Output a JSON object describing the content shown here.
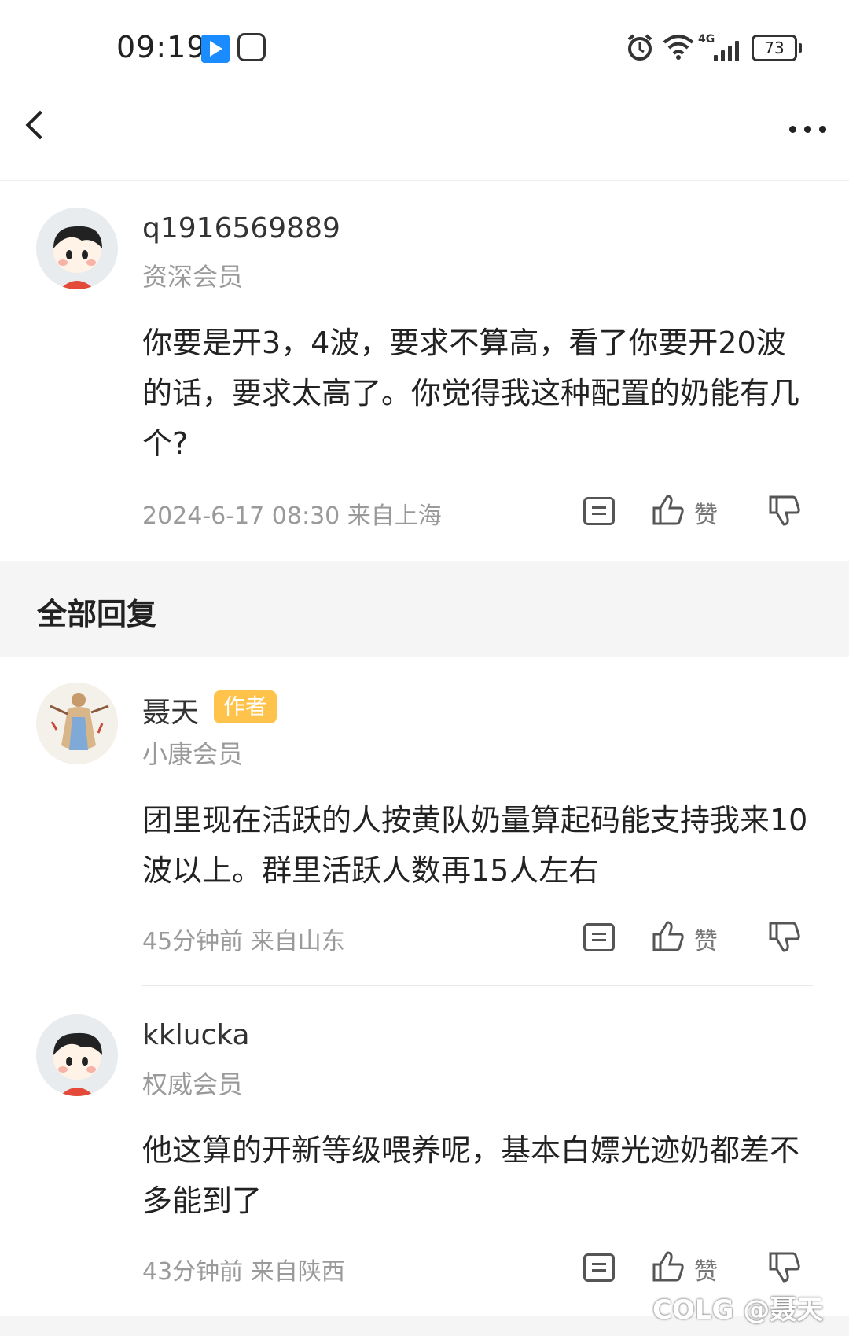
{
  "status_bar": {
    "time": "09:19",
    "battery": "73",
    "network": "4G"
  },
  "nav": {
    "back_icon": "chevron-left-icon",
    "more_icon": "more-horizontal-icon"
  },
  "main_comment": {
    "username": "q1916569889",
    "level": "资深会员",
    "content": "你要是开3，4波，要求不算高，看了你要开20波的话，要求太高了。你觉得我这种配置的奶能有几个?",
    "meta": "2024-6-17 08:30  来自上海",
    "like_label": "赞"
  },
  "section": {
    "title": "全部回复"
  },
  "replies": [
    {
      "username": "聂天",
      "badge": "作者",
      "level": "小康会员",
      "content": "团里现在活跃的人按黄队奶量算起码能支持我来10波以上。群里活跃人数再15人左右",
      "meta": "45分钟前  来自山东",
      "like_label": "赞"
    },
    {
      "username": "kklucka",
      "level": "权威会员",
      "content": "他这算的开新等级喂养呢，基本白嫖光迹奶都差不多能到了",
      "meta": "43分钟前  来自陕西",
      "like_label": "赞"
    }
  ],
  "watermark": "COLG @聂天"
}
